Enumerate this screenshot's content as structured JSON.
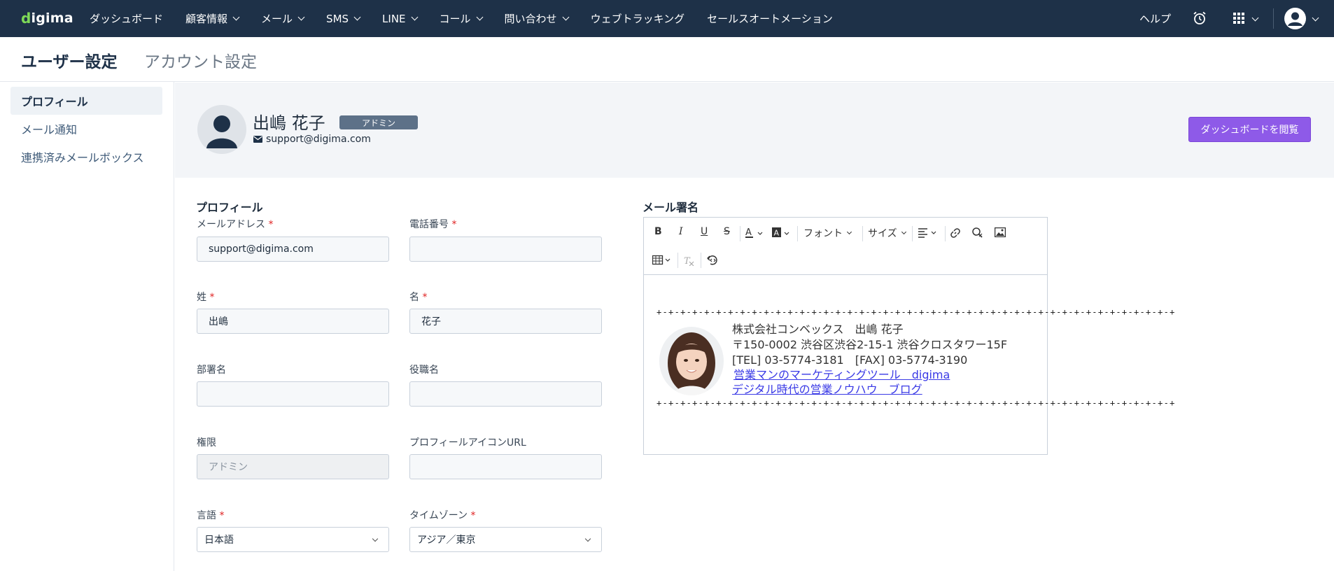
{
  "nav": {
    "logo": "digima",
    "items": [
      "ダッシュボード",
      "顧客情報",
      "メール",
      "SMS",
      "LINE",
      "コール",
      "問い合わせ",
      "ウェブトラッキング",
      "セールスオートメーション"
    ],
    "help": "ヘルプ"
  },
  "header": {
    "title": "ユーザー設定",
    "secondary": "アカウント設定"
  },
  "sidebar": {
    "items": [
      "プロフィール",
      "メール通知",
      "連携済みメールボックス"
    ]
  },
  "profile": {
    "name": "出嶋 花子",
    "role_badge": "アドミン",
    "email": "support@digima.com",
    "dashboard_button": "ダッシュボードを閲覧"
  },
  "form": {
    "section_title": "プロフィール",
    "email_label": "メールアドレス",
    "email_value": "support@digima.com",
    "phone_label": "電話番号",
    "phone_value": "",
    "last_name_label": "姓",
    "last_name_value": "出嶋",
    "first_name_label": "名",
    "first_name_value": "花子",
    "department_label": "部署名",
    "department_value": "",
    "title_label": "役職名",
    "title_value": "",
    "permission_label": "権限",
    "permission_value": "アドミン",
    "icon_url_label": "プロフィールアイコンURL",
    "icon_url_value": "",
    "language_label": "言語",
    "language_value": "日本語",
    "timezone_label": "タイムゾーン",
    "timezone_value": "アジア／東京",
    "required_mark": "*"
  },
  "signature": {
    "section_title": "メール署名",
    "toolbar": {
      "font": "フォント",
      "size": "サイズ",
      "bold": "B",
      "italic": "I",
      "underline": "U",
      "strike": "S"
    },
    "dash_line": "+-+-+-+-+-+-+-+-+-+-+-+-+-+-+-+-+-+-+-+-+-+-+-+-+-+-+-+-+-+-+-+-+-+-+-+-+-+-+-+-+-+-+-+",
    "company_line": "株式会社コンベックス　出嶋 花子",
    "address_line": "〒150-0002 渋谷区渋谷2-15-1 渋谷クロスタワー15F",
    "tel_line": "[TEL] 03-5774-3181　[FAX] 03-5774-3190",
    "link1": "営業マンのマーケティングツール　digima",
    "link2": "デジタル時代の営業ノウハウ　ブログ"
  },
  "colors": {
    "nav_bg": "#1e3148",
    "accent": "#8e5ae8",
    "required": "#e02424",
    "link": "#3a3ae6"
  }
}
